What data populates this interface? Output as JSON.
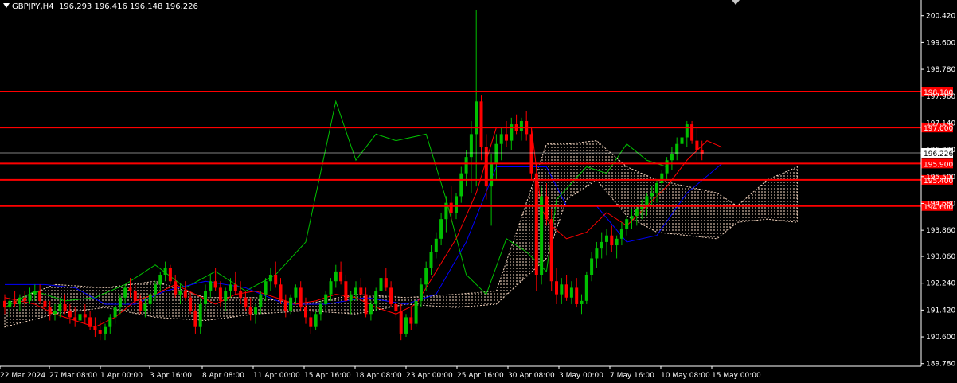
{
  "header": {
    "symbol": "GBPJPY,H4",
    "ohlc": "196.293 196.416 196.148 196.226"
  },
  "colors": {
    "background": "#000000",
    "axis": "#ffffff",
    "bull": "#00c000",
    "bear": "#ff0000",
    "level": "#ff0000",
    "tenkan": "#ff0000",
    "kijun": "#0000ff",
    "chikou": "#00c000",
    "cloud": "#f5d6c0",
    "current_price": "#ffffff"
  },
  "chart_data": {
    "type": "candlestick",
    "symbol": "GBPJPY",
    "timeframe": "H4",
    "ylim": [
      189.7,
      200.9
    ],
    "y_ticks": [
      "200.420",
      "199.600",
      "198.780",
      "197.960",
      "197.140",
      "196.320",
      "195.500",
      "194.680",
      "193.860",
      "193.060",
      "192.240",
      "191.420",
      "190.600",
      "189.780"
    ],
    "x_ticks": [
      "22 Mar 2024",
      "27 Mar 08:00",
      "1 Apr 00:00",
      "3 Apr 16:00",
      "8 Apr 08:00",
      "11 Apr 00:00",
      "15 Apr 16:00",
      "18 Apr 08:00",
      "23 Apr 00:00",
      "25 Apr 16:00",
      "30 Apr 08:00",
      "3 May 00:00",
      "7 May 16:00",
      "10 May 08:00",
      "15 May 00:00"
    ],
    "current_price": "196.226",
    "levels": [
      {
        "price": 198.1,
        "label": "198.100"
      },
      {
        "price": 197.0,
        "label": "197.000"
      },
      {
        "price": 195.9,
        "label": "195.900"
      },
      {
        "price": 195.4,
        "label": "195.400"
      },
      {
        "price": 194.6,
        "label": "194.600"
      }
    ],
    "candles": [
      [
        191.7,
        191.9,
        191.3,
        191.5
      ],
      [
        191.5,
        191.8,
        191.2,
        191.7
      ],
      [
        191.7,
        192.0,
        191.5,
        191.6
      ],
      [
        191.6,
        191.9,
        191.4,
        191.8
      ],
      [
        191.8,
        192.0,
        191.5,
        191.7
      ],
      [
        191.7,
        192.1,
        191.6,
        191.9
      ],
      [
        191.9,
        192.2,
        191.7,
        192.0
      ],
      [
        192.0,
        192.2,
        191.6,
        191.7
      ],
      [
        191.7,
        191.9,
        191.3,
        191.5
      ],
      [
        191.5,
        191.7,
        191.1,
        191.3
      ],
      [
        191.3,
        191.6,
        191.1,
        191.4
      ],
      [
        191.4,
        191.8,
        191.2,
        191.6
      ],
      [
        191.6,
        191.9,
        191.3,
        191.4
      ],
      [
        191.4,
        191.6,
        191.0,
        191.2
      ],
      [
        191.2,
        191.5,
        190.9,
        191.1
      ],
      [
        191.1,
        191.4,
        190.8,
        191.3
      ],
      [
        191.3,
        191.6,
        191.0,
        191.2
      ],
      [
        191.2,
        191.4,
        190.8,
        190.9
      ],
      [
        190.9,
        191.2,
        190.6,
        190.8
      ],
      [
        190.8,
        191.1,
        190.5,
        190.7
      ],
      [
        190.7,
        191.0,
        190.5,
        190.9
      ],
      [
        190.9,
        191.3,
        190.7,
        191.2
      ],
      [
        191.2,
        191.6,
        191.0,
        191.5
      ],
      [
        191.5,
        191.9,
        191.3,
        191.8
      ],
      [
        191.8,
        192.2,
        191.6,
        192.1
      ],
      [
        192.1,
        192.4,
        191.8,
        192.0
      ],
      [
        192.0,
        192.2,
        191.6,
        191.7
      ],
      [
        191.7,
        191.9,
        191.3,
        191.4
      ],
      [
        191.4,
        191.8,
        191.2,
        191.6
      ],
      [
        191.6,
        192.0,
        191.4,
        191.9
      ],
      [
        191.9,
        192.3,
        191.7,
        192.2
      ],
      [
        192.2,
        192.6,
        192.0,
        192.5
      ],
      [
        192.5,
        192.9,
        192.3,
        192.7
      ],
      [
        192.7,
        192.8,
        192.2,
        192.3
      ],
      [
        192.3,
        192.5,
        191.8,
        191.9
      ],
      [
        191.9,
        192.2,
        191.6,
        192.0
      ],
      [
        192.0,
        192.3,
        191.7,
        191.8
      ],
      [
        191.8,
        192.0,
        191.3,
        191.4
      ],
      [
        191.4,
        191.6,
        190.7,
        190.9
      ],
      [
        190.9,
        191.8,
        190.7,
        191.6
      ],
      [
        191.6,
        192.2,
        191.4,
        192.0
      ],
      [
        192.0,
        192.5,
        191.8,
        192.3
      ],
      [
        192.3,
        192.7,
        192.0,
        192.1
      ],
      [
        192.1,
        192.3,
        191.5,
        191.7
      ],
      [
        191.7,
        192.1,
        191.4,
        192.0
      ],
      [
        192.0,
        192.4,
        191.8,
        192.2
      ],
      [
        192.2,
        192.6,
        191.9,
        192.0
      ],
      [
        192.0,
        192.3,
        191.6,
        191.8
      ],
      [
        191.8,
        192.0,
        191.4,
        191.5
      ],
      [
        191.5,
        191.8,
        191.1,
        191.3
      ],
      [
        191.3,
        191.6,
        191.0,
        191.5
      ],
      [
        191.5,
        192.0,
        191.3,
        191.9
      ],
      [
        191.9,
        192.4,
        191.7,
        192.3
      ],
      [
        192.3,
        192.7,
        192.0,
        192.5
      ],
      [
        192.5,
        192.9,
        192.1,
        192.2
      ],
      [
        192.2,
        192.4,
        191.6,
        191.7
      ],
      [
        191.7,
        191.9,
        191.2,
        191.4
      ],
      [
        191.4,
        191.9,
        191.3,
        191.8
      ],
      [
        191.8,
        192.2,
        191.6,
        192.1
      ],
      [
        192.1,
        192.3,
        191.4,
        191.5
      ],
      [
        191.5,
        191.8,
        191.0,
        191.2
      ],
      [
        191.2,
        191.5,
        190.7,
        190.9
      ],
      [
        190.9,
        191.4,
        190.8,
        191.3
      ],
      [
        191.3,
        191.7,
        191.1,
        191.6
      ],
      [
        191.6,
        192.0,
        191.4,
        191.9
      ],
      [
        191.9,
        192.4,
        191.7,
        192.3
      ],
      [
        192.3,
        192.8,
        192.1,
        192.6
      ],
      [
        192.6,
        192.9,
        192.2,
        192.3
      ],
      [
        192.3,
        192.5,
        191.6,
        191.7
      ],
      [
        191.7,
        192.0,
        191.3,
        191.9
      ],
      [
        191.9,
        192.3,
        191.7,
        192.1
      ],
      [
        192.1,
        192.4,
        191.8,
        191.9
      ],
      [
        191.9,
        192.1,
        191.2,
        191.3
      ],
      [
        191.3,
        191.7,
        191.1,
        191.6
      ],
      [
        191.6,
        192.1,
        191.4,
        192.0
      ],
      [
        192.0,
        192.6,
        191.8,
        192.4
      ],
      [
        192.4,
        192.7,
        192.0,
        192.1
      ],
      [
        192.1,
        192.3,
        191.5,
        191.6
      ],
      [
        191.6,
        191.9,
        191.2,
        191.4
      ],
      [
        191.4,
        191.6,
        190.5,
        190.7
      ],
      [
        190.7,
        191.3,
        190.6,
        191.2
      ],
      [
        191.2,
        191.5,
        190.8,
        191.0
      ],
      [
        191.0,
        191.8,
        190.9,
        191.7
      ],
      [
        191.7,
        192.4,
        191.5,
        192.2
      ],
      [
        192.2,
        192.9,
        192.0,
        192.7
      ],
      [
        192.7,
        193.4,
        192.5,
        193.2
      ],
      [
        193.2,
        193.8,
        193.0,
        193.6
      ],
      [
        193.6,
        194.4,
        193.4,
        194.2
      ],
      [
        194.2,
        194.9,
        193.8,
        194.7
      ],
      [
        194.7,
        195.2,
        194.1,
        194.4
      ],
      [
        194.4,
        195.0,
        194.2,
        194.9
      ],
      [
        194.9,
        195.8,
        194.7,
        195.6
      ],
      [
        195.6,
        196.3,
        195.2,
        196.1
      ],
      [
        196.1,
        197.2,
        195.0,
        196.8
      ],
      [
        196.8,
        200.6,
        195.2,
        197.8
      ],
      [
        197.8,
        198.0,
        196.0,
        196.4
      ],
      [
        196.4,
        196.8,
        194.8,
        195.2
      ],
      [
        195.2,
        196.2,
        194.0,
        195.9
      ],
      [
        195.9,
        196.8,
        195.4,
        196.5
      ],
      [
        196.5,
        197.0,
        196.0,
        196.8
      ],
      [
        196.8,
        197.2,
        196.4,
        196.6
      ],
      [
        196.6,
        197.3,
        196.3,
        197.1
      ],
      [
        197.1,
        197.4,
        196.8,
        196.9
      ],
      [
        196.9,
        197.3,
        196.6,
        197.2
      ],
      [
        197.2,
        197.5,
        196.6,
        196.8
      ],
      [
        196.8,
        197.0,
        195.4,
        195.6
      ],
      [
        195.6,
        195.9,
        192.0,
        192.5
      ],
      [
        192.5,
        195.2,
        192.2,
        194.9
      ],
      [
        194.9,
        195.3,
        194.0,
        194.2
      ],
      [
        194.2,
        194.5,
        192.0,
        192.3
      ],
      [
        192.3,
        192.7,
        191.6,
        191.9
      ],
      [
        191.9,
        192.4,
        191.6,
        192.2
      ],
      [
        192.2,
        192.5,
        191.7,
        191.8
      ],
      [
        191.8,
        192.3,
        191.6,
        192.1
      ],
      [
        192.1,
        192.4,
        191.5,
        191.6
      ],
      [
        191.6,
        191.9,
        191.3,
        191.7
      ],
      [
        191.7,
        192.6,
        191.6,
        192.5
      ],
      [
        192.5,
        193.2,
        192.3,
        193.0
      ],
      [
        193.0,
        193.5,
        192.7,
        193.3
      ],
      [
        193.3,
        193.8,
        193.0,
        193.5
      ],
      [
        193.5,
        193.9,
        193.1,
        193.7
      ],
      [
        193.7,
        194.0,
        193.2,
        193.4
      ],
      [
        193.4,
        193.7,
        193.0,
        193.6
      ],
      [
        193.6,
        194.1,
        193.4,
        193.9
      ],
      [
        193.9,
        194.3,
        193.7,
        194.2
      ],
      [
        194.2,
        194.5,
        193.9,
        194.3
      ],
      [
        194.3,
        194.6,
        194.0,
        194.5
      ],
      [
        194.5,
        194.8,
        194.2,
        194.6
      ],
      [
        194.6,
        195.0,
        194.3,
        194.9
      ],
      [
        194.9,
        195.2,
        194.6,
        195.0
      ],
      [
        195.0,
        195.4,
        194.7,
        195.3
      ],
      [
        195.3,
        195.7,
        195.0,
        195.6
      ],
      [
        195.6,
        196.1,
        195.4,
        196.0
      ],
      [
        196.0,
        196.4,
        195.7,
        196.2
      ],
      [
        196.2,
        196.7,
        196.0,
        196.5
      ],
      [
        196.5,
        196.9,
        196.2,
        196.7
      ],
      [
        196.7,
        197.2,
        196.4,
        197.1
      ],
      [
        197.1,
        197.2,
        196.5,
        196.6
      ],
      [
        196.6,
        197.0,
        196.0,
        196.3
      ],
      [
        196.3,
        196.6,
        196.0,
        196.2
      ]
    ],
    "tenkan": [
      [
        0,
        191.8
      ],
      [
        6,
        191.6
      ],
      [
        10,
        191.3
      ],
      [
        14,
        191.1
      ],
      [
        18,
        190.9
      ],
      [
        22,
        191.2
      ],
      [
        26,
        191.7
      ],
      [
        30,
        191.9
      ],
      [
        34,
        192.2
      ],
      [
        38,
        191.9
      ],
      [
        42,
        191.6
      ],
      [
        46,
        191.9
      ],
      [
        50,
        192.0
      ],
      [
        54,
        191.8
      ],
      [
        58,
        191.6
      ],
      [
        62,
        191.7
      ],
      [
        66,
        191.9
      ],
      [
        70,
        191.8
      ],
      [
        74,
        191.5
      ],
      [
        78,
        191.3
      ],
      [
        82,
        191.6
      ],
      [
        86,
        192.6
      ],
      [
        90,
        193.6
      ],
      [
        94,
        195.0
      ],
      [
        98,
        197.0
      ],
      [
        102,
        197.0
      ],
      [
        105,
        197.0
      ],
      [
        107,
        194.5
      ],
      [
        109,
        194.0
      ],
      [
        112,
        193.6
      ],
      [
        116,
        193.8
      ],
      [
        120,
        194.4
      ],
      [
        124,
        194.0
      ],
      [
        128,
        194.6
      ],
      [
        132,
        195.2
      ],
      [
        136,
        196.0
      ],
      [
        140,
        196.6
      ],
      [
        143,
        196.4
      ]
    ],
    "kijun": [
      [
        0,
        192.2
      ],
      [
        8,
        192.2
      ],
      [
        14,
        192.1
      ],
      [
        20,
        191.6
      ],
      [
        26,
        191.6
      ],
      [
        32,
        192.0
      ],
      [
        40,
        192.3
      ],
      [
        48,
        192.1
      ],
      [
        56,
        191.6
      ],
      [
        64,
        191.6
      ],
      [
        72,
        191.8
      ],
      [
        80,
        191.6
      ],
      [
        86,
        191.9
      ],
      [
        92,
        193.5
      ],
      [
        98,
        195.8
      ],
      [
        104,
        195.8
      ],
      [
        108,
        195.8
      ],
      [
        112,
        194.6
      ],
      [
        118,
        194.6
      ],
      [
        124,
        193.5
      ],
      [
        130,
        193.7
      ],
      [
        136,
        195.0
      ],
      [
        143,
        195.9
      ]
    ],
    "chikou": [
      [
        0,
        191.5
      ],
      [
        6,
        192.0
      ],
      [
        12,
        191.7
      ],
      [
        18,
        191.8
      ],
      [
        24,
        192.2
      ],
      [
        30,
        192.8
      ],
      [
        36,
        192.1
      ],
      [
        42,
        192.6
      ],
      [
        48,
        192.0
      ],
      [
        54,
        192.5
      ],
      [
        60,
        193.5
      ],
      [
        66,
        197.8
      ],
      [
        70,
        196.0
      ],
      [
        74,
        196.8
      ],
      [
        78,
        196.6
      ],
      [
        84,
        196.8
      ],
      [
        88,
        194.8
      ],
      [
        92,
        192.5
      ],
      [
        96,
        191.9
      ],
      [
        100,
        193.6
      ],
      [
        104,
        193.2
      ],
      [
        108,
        192.6
      ],
      [
        110,
        194.8
      ],
      [
        116,
        195.8
      ],
      [
        120,
        195.6
      ],
      [
        124,
        196.5
      ],
      [
        128,
        196.0
      ],
      [
        132,
        195.8
      ]
    ],
    "cloud": [
      [
        0,
        190.9,
        191.6
      ],
      [
        10,
        191.3,
        192.2
      ],
      [
        20,
        191.5,
        192.1
      ],
      [
        30,
        191.2,
        192.3
      ],
      [
        40,
        191.1,
        191.8
      ],
      [
        50,
        191.3,
        191.8
      ],
      [
        60,
        191.4,
        191.6
      ],
      [
        70,
        191.3,
        191.9
      ],
      [
        80,
        191.6,
        191.8
      ],
      [
        90,
        191.5,
        191.9
      ],
      [
        98,
        191.6,
        192.0
      ],
      [
        108,
        193.0,
        196.5
      ],
      [
        112,
        194.8,
        196.5
      ],
      [
        118,
        195.4,
        196.6
      ],
      [
        124,
        194.3,
        195.8
      ],
      [
        130,
        193.8,
        195.4
      ],
      [
        136,
        193.7,
        195.2
      ],
      [
        142,
        193.6,
        195.0
      ],
      [
        146,
        194.1,
        194.6
      ],
      [
        152,
        194.2,
        195.4
      ],
      [
        158,
        194.1,
        195.8
      ]
    ]
  }
}
